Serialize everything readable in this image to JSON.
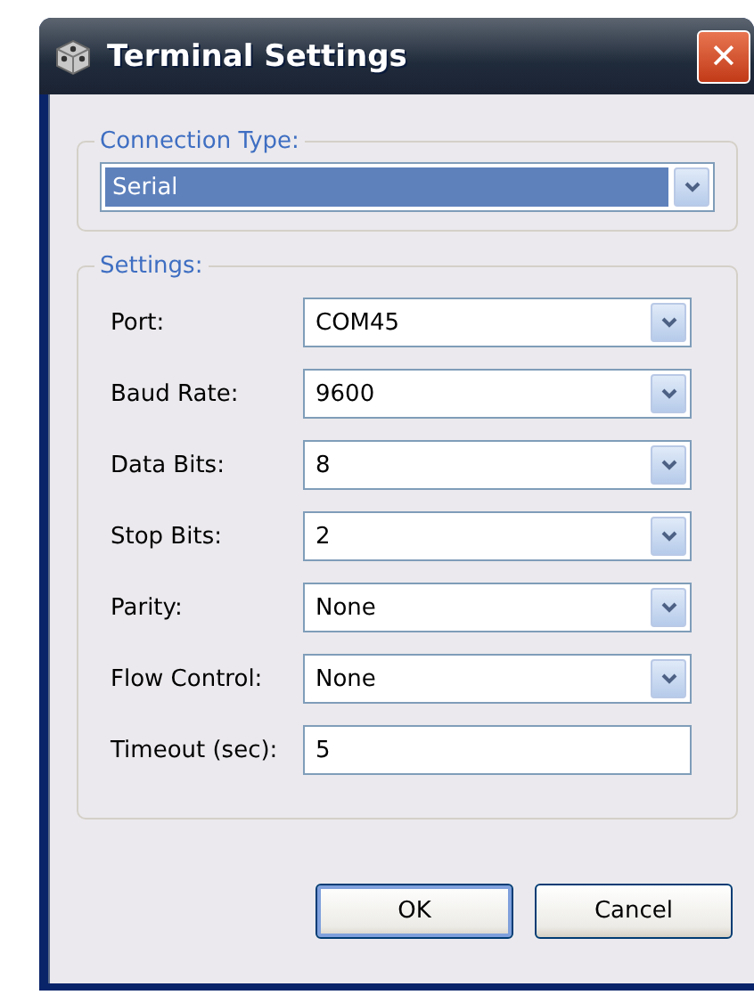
{
  "window": {
    "title": "Terminal Settings",
    "close_button": "✕"
  },
  "connection_type": {
    "legend": "Connection Type:",
    "value": "Serial",
    "highlighted": true
  },
  "settings": {
    "legend": "Settings:",
    "fields": [
      {
        "label": "Port:",
        "kind": "combo",
        "value": "COM45"
      },
      {
        "label": "Baud Rate:",
        "kind": "combo",
        "value": "9600"
      },
      {
        "label": "Data Bits:",
        "kind": "combo",
        "value": "8"
      },
      {
        "label": "Stop Bits:",
        "kind": "combo",
        "value": "2"
      },
      {
        "label": "Parity:",
        "kind": "combo",
        "value": "None"
      },
      {
        "label": "Flow Control:",
        "kind": "combo",
        "value": "None"
      },
      {
        "label": "Timeout (sec):",
        "kind": "text",
        "value": "5"
      }
    ]
  },
  "buttons": [
    {
      "label": "OK",
      "default": true
    },
    {
      "label": "Cancel",
      "default": false
    }
  ]
}
